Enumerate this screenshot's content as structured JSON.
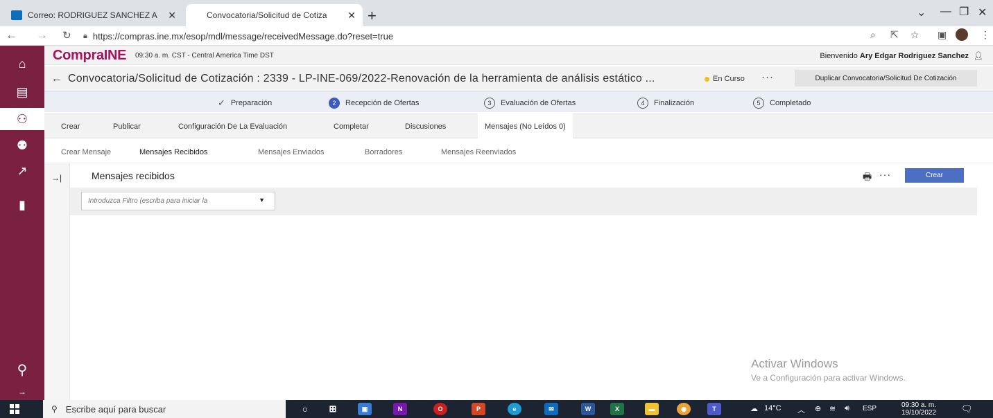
{
  "browser": {
    "tabs": [
      {
        "title": "Correo: RODRIGUEZ SANCHEZ A",
        "favicon_color": "#0a6ebd"
      },
      {
        "title": "Convocatoria/Solicitud de Cotiza",
        "favicon_color": ""
      }
    ],
    "new_tab": "+",
    "url": "https://compras.ine.mx/esop/mdl/message/receivedMessage.do?reset=true"
  },
  "sidebar": {
    "icons": [
      "home-icon",
      "dashboard-icon",
      "handshake-icon",
      "users-icon",
      "analytics-icon",
      "documents-icon",
      "search-icon"
    ],
    "active_index": 2,
    "expand": "→"
  },
  "app_header": {
    "logo": "CompraINE",
    "time": "09:30 a. m. CST - Central America Time DST",
    "welcome_prefix": "Bienvenido",
    "user_name": "Ary Edgar Rodriguez Sanchez"
  },
  "title_row": {
    "back": "←",
    "title": "Convocatoria/Solicitud de Cotización : 2339 - LP-INE-069/2022-Renovación de la herramienta de análisis estático ...",
    "status": "En Curso",
    "more": "···",
    "duplicate_button": "Duplicar Convocatoria/Solicitud De Cotización"
  },
  "steps": [
    {
      "num": "",
      "label": "Preparación",
      "state": "done"
    },
    {
      "num": "2",
      "label": "Recepción de Ofertas",
      "state": "current"
    },
    {
      "num": "3",
      "label": "Evaluación de Ofertas",
      "state": "todo"
    },
    {
      "num": "4",
      "label": "Finalización",
      "state": "todo"
    },
    {
      "num": "5",
      "label": "Completado",
      "state": "todo"
    }
  ],
  "main_tabs": [
    "Crear",
    "Publicar",
    "Configuración De La Evaluación",
    "Completar",
    "Discusiones",
    "Mensajes (No Leídos 0)"
  ],
  "main_tabs_active": 5,
  "sub_tabs": [
    "Crear Mensaje",
    "Mensajes Recibidos",
    "Mensajes Enviados",
    "Borradores",
    "Mensajes Reenviados"
  ],
  "sub_tabs_active": 1,
  "panel": {
    "title": "Mensajes recibidos",
    "more": "···",
    "create_button": "Crear",
    "filter_placeholder": "Introduzca Filtro (escriba para iniciar la"
  },
  "watermark": {
    "line1": "Activar Windows",
    "line2": "Ve a Configuración para activar Windows."
  },
  "taskbar": {
    "search_placeholder": "Escribe aquí para buscar",
    "weather": "14°C",
    "language": "ESP",
    "time": "09:30 a. m.",
    "date": "19/10/2022"
  },
  "colors": {
    "brand": "#a3145c",
    "sidebar": "#7a2040",
    "accent": "#4c6ec3"
  }
}
